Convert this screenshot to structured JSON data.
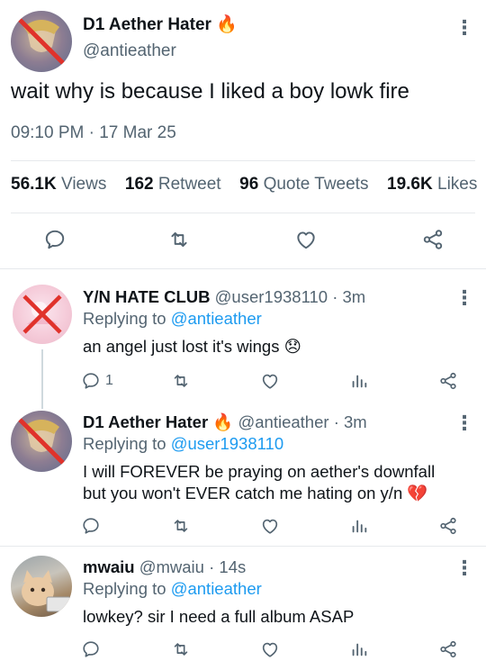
{
  "main_tweet": {
    "display_name": "D1 Aether Hater",
    "emoji": "🔥",
    "handle": "@antieather",
    "text": "wait why is because I liked a boy lowk fire",
    "timestamp": "09:10 PM · 17 Mar 25",
    "stats": {
      "views_count": "56.1K",
      "views_label": "Views",
      "retweets_count": "162",
      "retweets_label": "Retweet",
      "quotes_count": "96",
      "quotes_label": "Quote Tweets",
      "likes_count": "19.6K",
      "likes_label": "Likes"
    }
  },
  "replies": [
    {
      "display_name": "Y/N HATE CLUB",
      "handle": "@user1938110",
      "time": "· 3m",
      "replying_prefix": "Replying to",
      "replying_to": "@antieather",
      "text": "an angel just lost it's wings",
      "emoji": "😞",
      "reply_count": "1"
    },
    {
      "display_name": "D1 Aether Hater",
      "name_emoji": "🔥",
      "handle": "@antieather",
      "time": "· 3m",
      "replying_prefix": "Replying to",
      "replying_to": "@user1938110",
      "text_line1": "I will FOREVER be praying on aether's downfall",
      "text_line2": "but you won't EVER catch me hating on y/n",
      "emoji": "💔"
    },
    {
      "display_name": "mwaiu",
      "handle": "@mwaiu",
      "time": "· 14s",
      "replying_prefix": "Replying to",
      "replying_to": "@antieather",
      "text": "lowkey? sir I need a full album ASAP"
    }
  ],
  "icons": {
    "more": "more-vertical-icon",
    "reply": "reply-icon",
    "retweet": "retweet-icon",
    "like": "heart-icon",
    "analytics": "analytics-icon",
    "share": "share-icon"
  },
  "colors": {
    "link": "#1d9bf0",
    "muted": "#536471",
    "no_symbol": "#e0322b"
  }
}
